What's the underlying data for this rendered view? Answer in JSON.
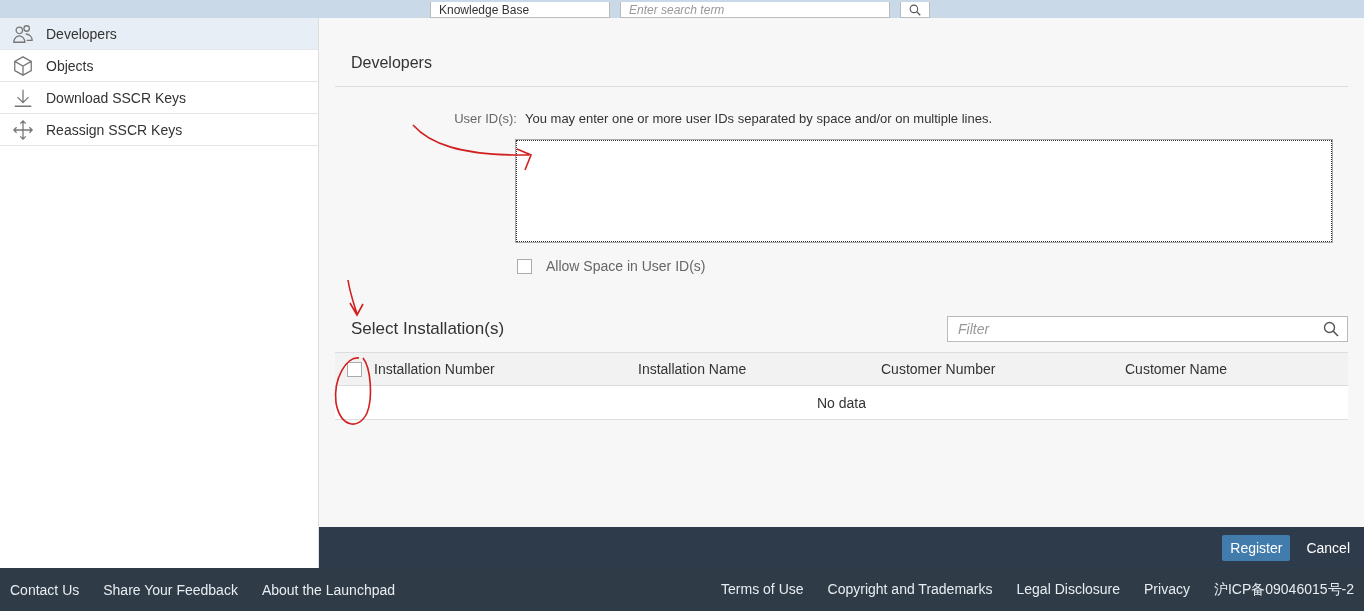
{
  "top_bar": {
    "scope": "Knowledge Base",
    "search": {
      "placeholder": "Enter search term"
    }
  },
  "sidebar": {
    "items": [
      {
        "kind": "people",
        "label": "Developers",
        "selected": true
      },
      {
        "kind": "cube",
        "label": "Objects",
        "selected": false
      },
      {
        "kind": "download",
        "label": "Download SSCR Keys",
        "selected": false
      },
      {
        "kind": "move",
        "label": "Reassign SSCR Keys",
        "selected": false
      }
    ]
  },
  "form": {
    "title": "Developers",
    "user_ids": {
      "label": "User ID(s):",
      "hint": "You may enter one or more user IDs separated by space and/or on multiple lines."
    },
    "allow_space": {
      "label": "Allow Space in User ID(s)",
      "checked": false
    }
  },
  "installations": {
    "title": "Select Installation(s)",
    "filter": {
      "placeholder": "Filter"
    },
    "select_all": {
      "checked": false
    },
    "columns": [
      "Installation Number",
      "Installation Name",
      "Customer Number",
      "Customer Name"
    ],
    "empty_text": "No data"
  },
  "actions": [
    {
      "label": "Register",
      "kind": "primary"
    },
    {
      "label": "Cancel",
      "kind": "plain"
    }
  ],
  "footer": {
    "left": [
      "Contact Us",
      "Share Your Feedback",
      "About the Launchpad"
    ],
    "right": [
      "Terms of Use",
      "Copyright and Trademarks",
      "Legal Disclosure",
      "Privacy",
      "沪ICP备09046015号-2"
    ]
  }
}
